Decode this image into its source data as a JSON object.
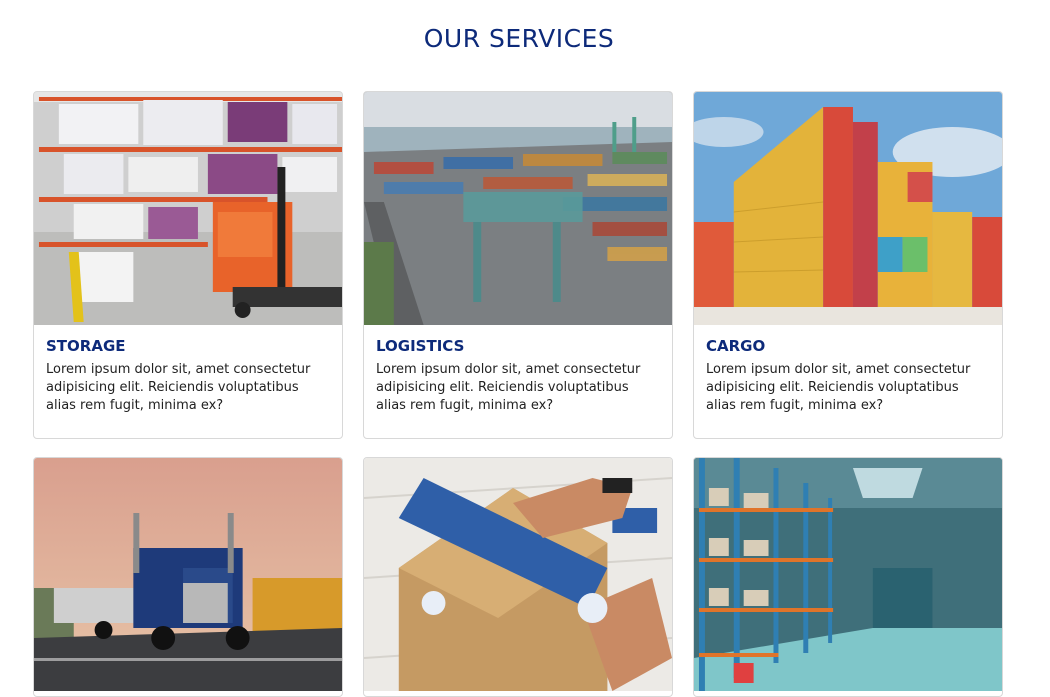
{
  "section": {
    "title": "OUR SERVICES"
  },
  "cards": [
    {
      "title": "STORAGE",
      "image": "warehouse-forklift-photo",
      "text": "Lorem ipsum dolor sit, amet consectetur adipisicing elit. Reiciendis voluptatibus alias rem fugit, minima ex?"
    },
    {
      "title": "LOGISTICS",
      "image": "container-port-aerial-photo",
      "text": "Lorem ipsum dolor sit, amet consectetur adipisicing elit. Reiciendis voluptatibus alias rem fugit, minima ex?"
    },
    {
      "title": "CARGO",
      "image": "stacked-containers-photo",
      "text": "Lorem ipsum dolor sit, amet consectetur adipisicing elit. Reiciendis voluptatibus alias rem fugit, minima ex?"
    },
    {
      "image": "truck-on-road-photo"
    },
    {
      "image": "packing-box-tape-photo"
    },
    {
      "image": "warehouse-shelves-photo"
    }
  ],
  "colors": {
    "heading": "#0d2a7a",
    "text": "#222222",
    "border": "#d8d8d8"
  }
}
